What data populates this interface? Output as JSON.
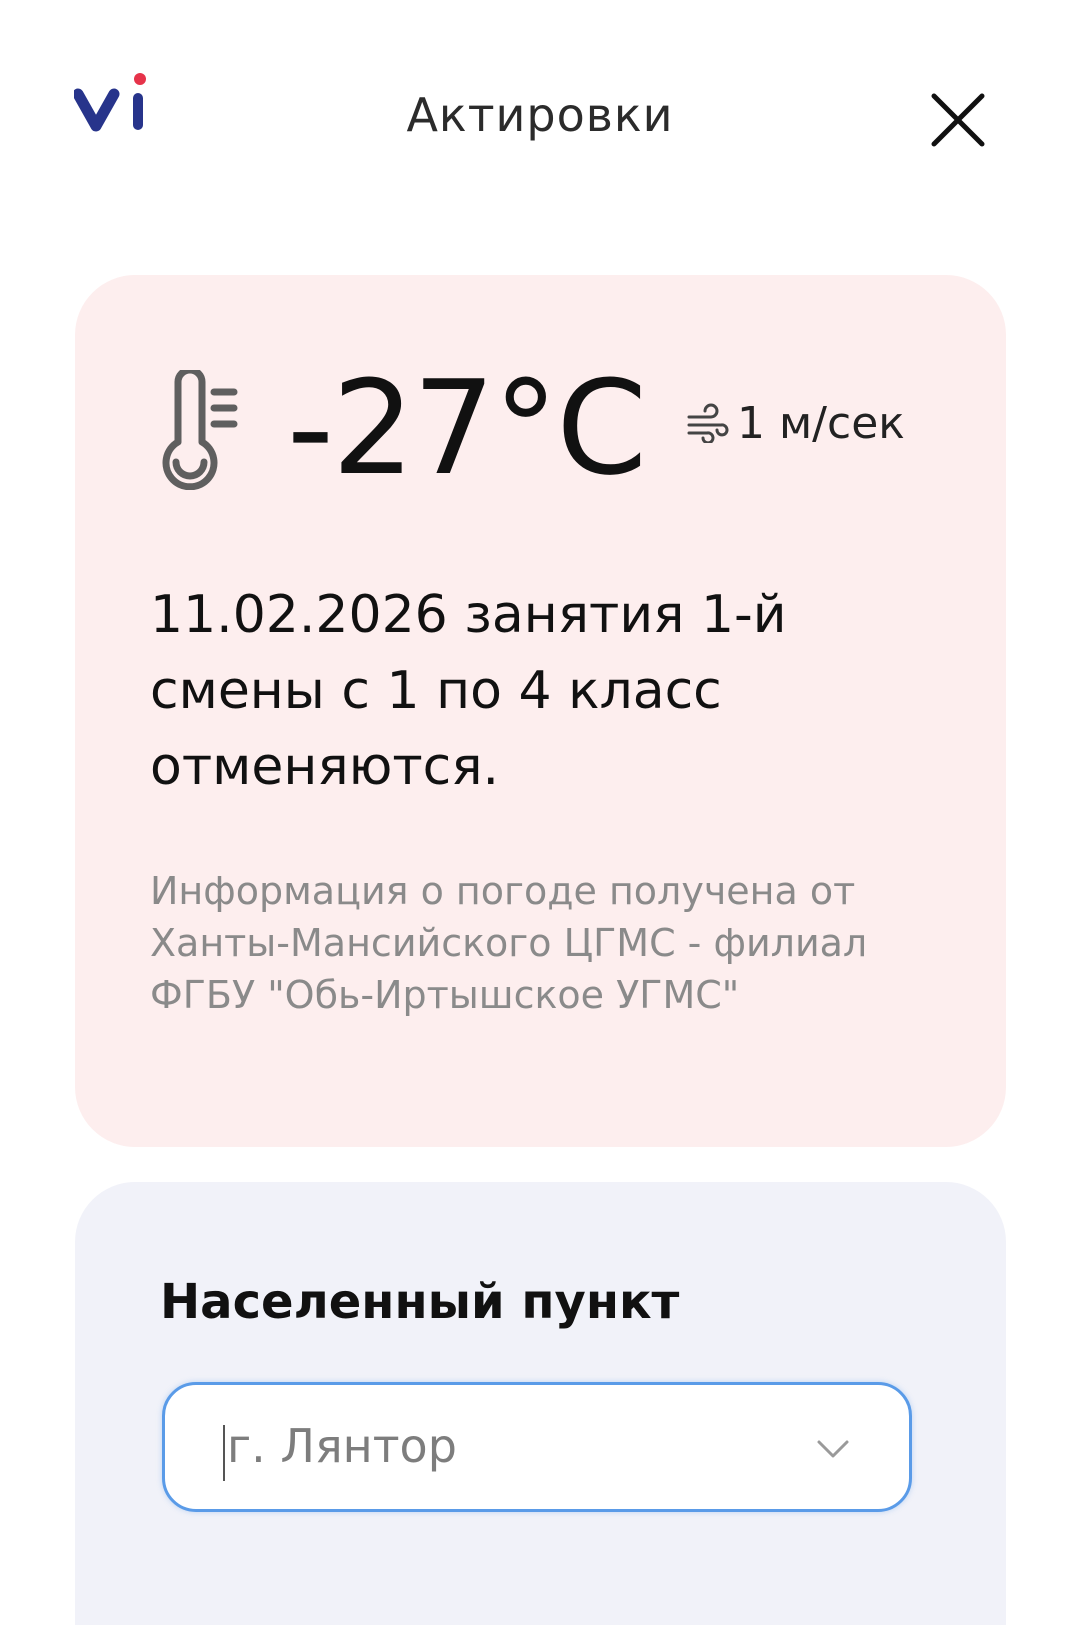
{
  "header": {
    "title": "Актировки",
    "logo_icon": "vi-logo",
    "close_icon": "close-icon"
  },
  "weather": {
    "temperature": "-27°C",
    "wind": "1 м/сек",
    "notice": "11.02.2026 занятия 1-й смены с 1 по 4 класс отменяются.",
    "source": "Информация о погоде получена от Ханты-Мансийского ЦГМС - филиал ФГБУ \"Обь-Иртышское УГМС\""
  },
  "location": {
    "label": "Населенный пункт",
    "selected_value": "г. Лянтор"
  },
  "colors": {
    "logo_blue": "#27348b",
    "logo_dot": "#e6334a",
    "weather_card_bg": "#fdeeee",
    "location_card_bg": "#f1f2f9",
    "select_border": "#5a9be8"
  }
}
